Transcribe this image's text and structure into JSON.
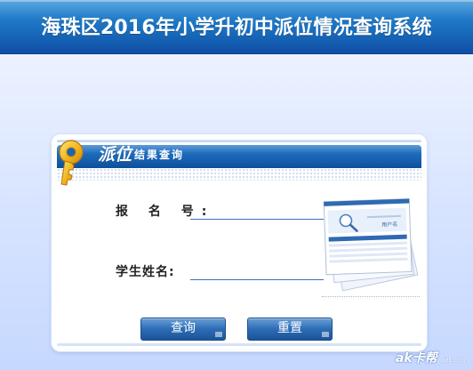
{
  "header": {
    "title": "海珠区2016年小学升初中派位情况查询系统"
  },
  "panel": {
    "title_main": "派位",
    "title_sub": "结果查询",
    "illustration_text": "用户名"
  },
  "form": {
    "exam_number_label": "报 名 号:",
    "exam_number_value": "",
    "student_name_label": "学生姓名:",
    "student_name_value": ""
  },
  "buttons": {
    "query_label": "查询",
    "reset_label": "重置"
  },
  "watermark": {
    "main": "ak卡帮",
    "sub": "jzb.com"
  },
  "icons": {
    "key": "key-icon",
    "illustration": "documents-search-illustration"
  },
  "colors": {
    "header_blue": "#1a6fbf",
    "panel_title_blue": "#1964b5",
    "button_blue": "#2d6cb6",
    "key_gold": "#f2b51e",
    "background": "#d6e3ff"
  }
}
